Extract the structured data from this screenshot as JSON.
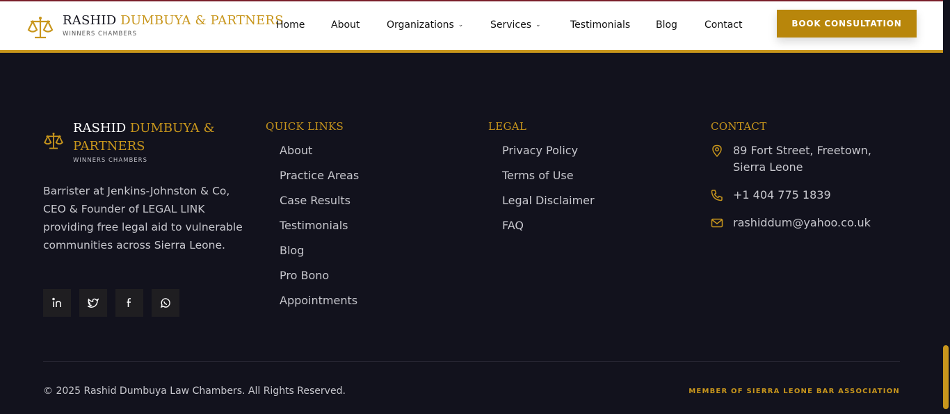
{
  "header": {
    "brand_name_first": "RASHID",
    "brand_name_rest": "DUMBUYA & PARTNERS",
    "brand_sub": "WINNERS CHAMBERS",
    "nav": [
      "Home",
      "About",
      "Organizations",
      "Services",
      "Testimonials",
      "Blog",
      "Contact"
    ],
    "cta": "BOOK CONSULTATION"
  },
  "footer": {
    "brand_name_first": "RASHID",
    "brand_name_rest": "DUMBUYA & PARTNERS",
    "brand_sub": "WINNERS CHAMBERS",
    "about": "Barrister at Jenkins-Johnston & Co, CEO & Founder of LEGAL LINK providing free legal aid to vulnerable communities across Sierra Leone.",
    "quick_links_title": "QUICK LINKS",
    "quick_links": [
      "About",
      "Practice Areas",
      "Case Results",
      "Testimonials",
      "Blog",
      "Pro Bono",
      "Appointments"
    ],
    "legal_title": "LEGAL",
    "legal_links": [
      "Privacy Policy",
      "Terms of Use",
      "Legal Disclaimer",
      "FAQ"
    ],
    "contact_title": "CONTACT",
    "address": "89 Fort Street, Freetown, Sierra Leone",
    "phone": "+1 404 775 1839",
    "email": "rashiddum@yahoo.co.uk",
    "copyright": "© 2025 Rashid Dumbuya Law Chambers. All Rights Reserved.",
    "member": "MEMBER OF SIERRA LEONE BAR ASSOCIATION"
  },
  "colors": {
    "gold": "#c8961c",
    "background": "#12121d",
    "header_bg": "#ffffff"
  },
  "icons": [
    "scales-icon",
    "linkedin-icon",
    "twitter-icon",
    "facebook-icon",
    "whatsapp-icon",
    "location-pin-icon",
    "phone-icon",
    "mail-icon",
    "chevron-down-icon"
  ]
}
